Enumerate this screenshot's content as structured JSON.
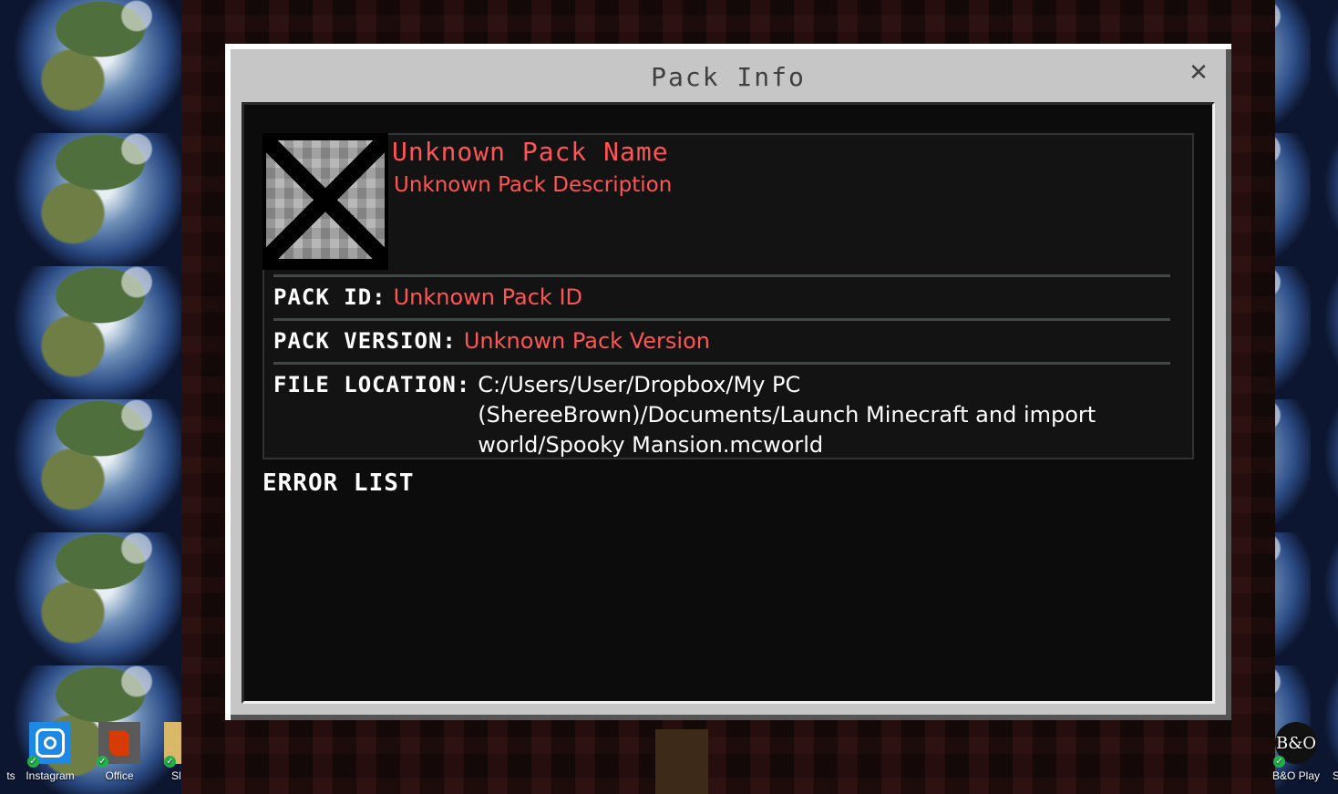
{
  "desktop": {
    "left_partial_label": "ts",
    "icons": [
      {
        "label": "Instagram",
        "icon": "instagram-icon"
      },
      {
        "label": "Office",
        "icon": "office-icon"
      }
    ],
    "mid_partial_label": "Sl",
    "right_icons": [
      {
        "label": "B&O Play",
        "icon": "bang-olufsen-icon",
        "glyph": "B&O"
      }
    ],
    "right_partial_label": "S",
    "sync_check_glyph": "✓"
  },
  "dialog": {
    "title": "Pack Info",
    "close_glyph": "✕",
    "pack": {
      "name": "Unknown Pack Name",
      "description": "Unknown Pack Description",
      "icon": "missing-pack-texture-icon"
    },
    "rows": [
      {
        "label": "PACK ID:",
        "value": "Unknown Pack ID"
      },
      {
        "label": "PACK VERSION:",
        "value": "Unknown Pack Version"
      },
      {
        "label": "FILE LOCATION:",
        "value": "C:/Users/User/Dropbox/My PC (ShereeBrown)/Documents/Launch Minecraft and import world/Spooky Mansion.mcworld"
      }
    ],
    "error_list_heading": "ERROR LIST"
  },
  "colors": {
    "error_red": "#ff5555",
    "dialog_frame": "#c6c6c6",
    "panel_bg": "#0c0c0c"
  }
}
